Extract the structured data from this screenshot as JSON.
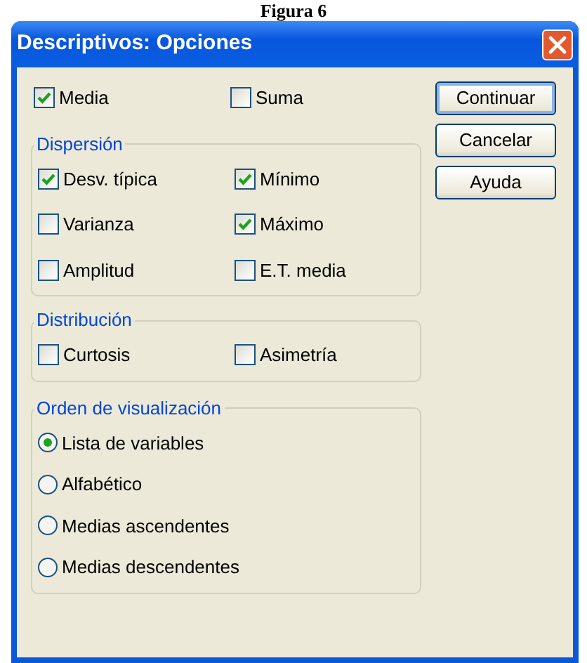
{
  "caption": "Figura 6",
  "window": {
    "title": "Descriptivos: Opciones"
  },
  "top_options": [
    {
      "label": "Media",
      "checked": true
    },
    {
      "label": "Suma",
      "checked": false
    }
  ],
  "groups": [
    {
      "title": "Dispersión",
      "kind": "checkboxes",
      "options": [
        {
          "label": "Desv. típica",
          "checked": true
        },
        {
          "label": "Mínimo",
          "checked": true
        },
        {
          "label": "Varianza",
          "checked": false
        },
        {
          "label": "Máximo",
          "checked": true
        },
        {
          "label": "Amplitud",
          "checked": false
        },
        {
          "label": "E.T. media",
          "checked": false
        }
      ]
    },
    {
      "title": "Distribución",
      "kind": "checkboxes",
      "options": [
        {
          "label": "Curtosis",
          "checked": false
        },
        {
          "label": "Asimetría",
          "checked": false
        }
      ]
    },
    {
      "title": "Orden de visualización",
      "kind": "radios",
      "options": [
        {
          "label": "Lista de variables",
          "selected": true
        },
        {
          "label": "Alfabético",
          "selected": false
        },
        {
          "label": "Medias ascendentes",
          "selected": false
        },
        {
          "label": "Medias descendentes",
          "selected": false
        }
      ]
    }
  ],
  "buttons": [
    {
      "label": "Continuar",
      "default": true
    },
    {
      "label": "Cancelar",
      "default": false
    },
    {
      "label": "Ayuda",
      "default": false
    }
  ]
}
